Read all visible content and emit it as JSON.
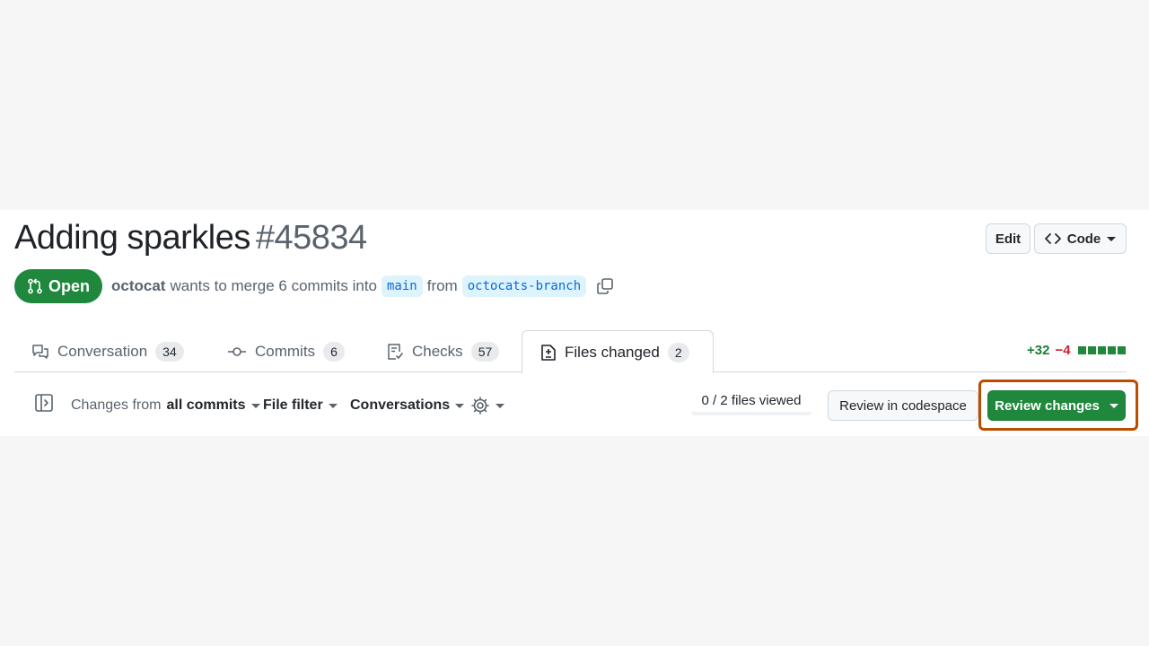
{
  "pr": {
    "title": "Adding sparkles",
    "number": "#45834",
    "state": "Open",
    "author": "octocat",
    "merge_text": "wants to merge 6 commits into",
    "base_branch": "main",
    "from_text": "from",
    "head_branch": "octocats-branch"
  },
  "header_buttons": {
    "edit": "Edit",
    "code": "Code"
  },
  "tabs": [
    {
      "label": "Conversation",
      "count": "34",
      "icon": "comment-discussion-icon"
    },
    {
      "label": "Commits",
      "count": "6",
      "icon": "git-commit-icon"
    },
    {
      "label": "Checks",
      "count": "57",
      "icon": "checklist-icon"
    },
    {
      "label": "Files changed",
      "count": "2",
      "icon": "file-diff-icon",
      "selected": true
    }
  ],
  "diffstat": {
    "additions": "+32",
    "deletions": "−4",
    "colors": {
      "add": "#1a7f37",
      "del": "#cf222e"
    }
  },
  "toolbar": {
    "changes_prefix": "Changes from",
    "changes_value": "all commits",
    "file_filter": "File filter",
    "conversations": "Conversations",
    "files_viewed": "0 / 2 files viewed",
    "review_codespace": "Review in codespace",
    "review_changes": "Review changes"
  },
  "colors": {
    "accent_green": "#1f883d",
    "highlight": "#bc4c00",
    "link_blue": "#0969da"
  }
}
